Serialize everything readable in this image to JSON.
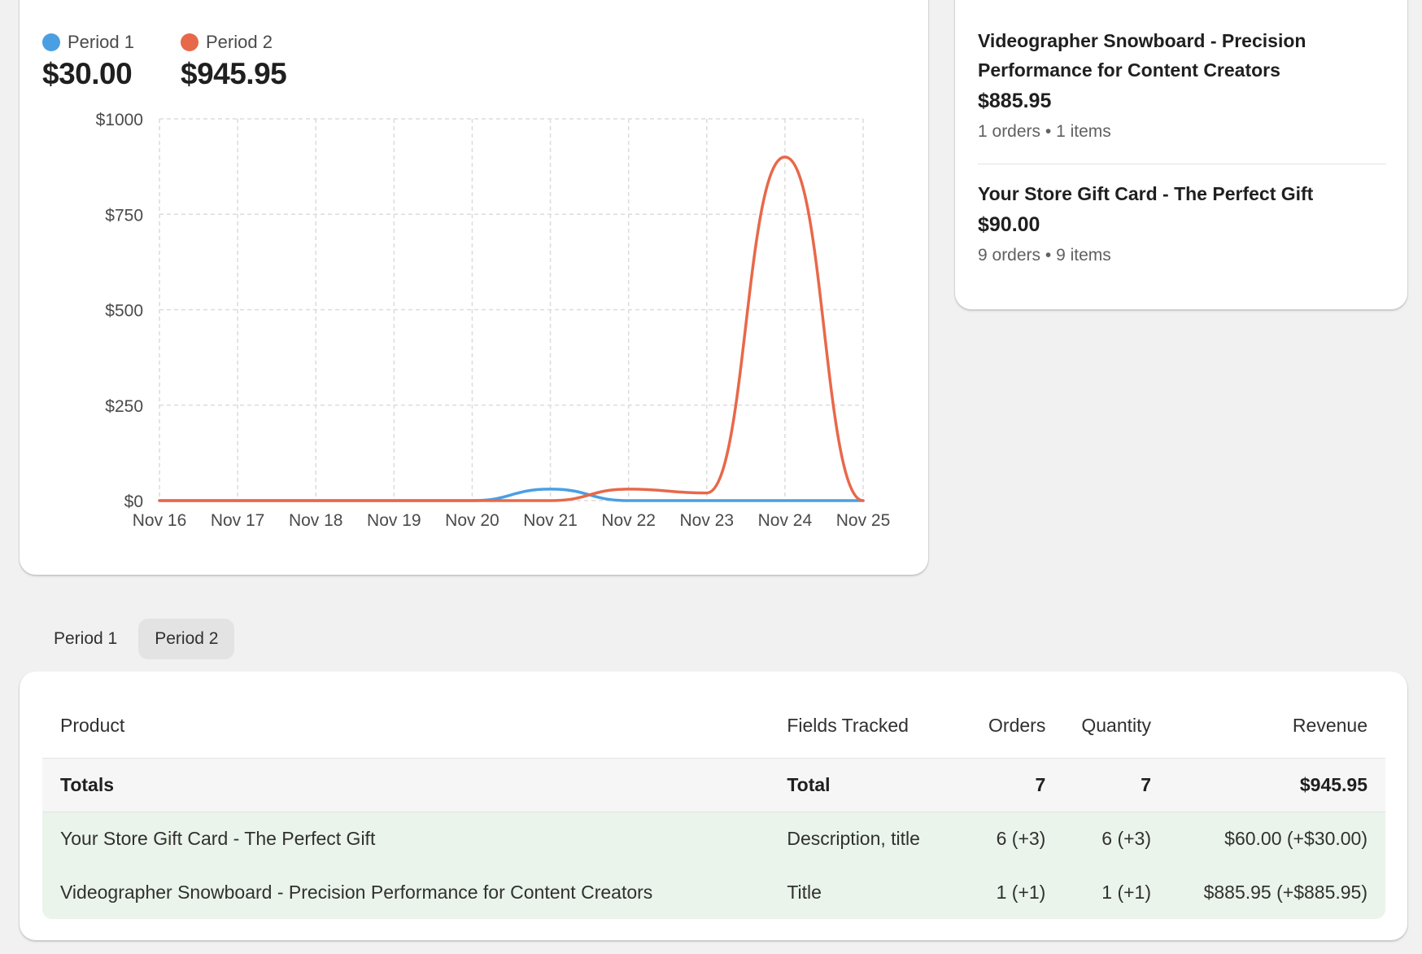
{
  "legend": [
    {
      "label": "Period 1",
      "value": "$30.00",
      "color": "#4a9fe3"
    },
    {
      "label": "Period 2",
      "value": "$945.95",
      "color": "#e8684a"
    }
  ],
  "chart_data": {
    "type": "line",
    "x": [
      "Nov 16",
      "Nov 17",
      "Nov 18",
      "Nov 19",
      "Nov 20",
      "Nov 21",
      "Nov 22",
      "Nov 23",
      "Nov 24",
      "Nov 25"
    ],
    "y_ticks": [
      "$0",
      "$250",
      "$500",
      "$750",
      "$1000"
    ],
    "ylim": [
      0,
      1000
    ],
    "grid": true,
    "series": [
      {
        "name": "Period 1",
        "color": "#4a9fe3",
        "values": [
          0,
          0,
          0,
          0,
          0,
          30,
          0,
          0,
          0,
          0
        ]
      },
      {
        "name": "Period 2",
        "color": "#e8684a",
        "values": [
          0,
          0,
          0,
          0,
          0,
          0,
          30,
          20,
          900,
          0
        ]
      }
    ]
  },
  "top_products": [
    {
      "title": "Videographer Snowboard - Precision Performance for Content Creators",
      "price": "$885.95",
      "orders": "1 orders",
      "items": "1 items"
    },
    {
      "title": "Your Store Gift Card - The Perfect Gift",
      "price": "$90.00",
      "orders": "9 orders",
      "items": "9 items"
    }
  ],
  "meta_separator": "•",
  "tabs": [
    {
      "label": "Period 1",
      "active": false
    },
    {
      "label": "Period 2",
      "active": true
    }
  ],
  "table": {
    "headers": {
      "product": "Product",
      "fields": "Fields Tracked",
      "orders": "Orders",
      "quantity": "Quantity",
      "revenue": "Revenue"
    },
    "totals": {
      "product": "Totals",
      "fields": "Total",
      "orders": "7",
      "quantity": "7",
      "revenue": "$945.95"
    },
    "rows": [
      {
        "product": "Your Store Gift Card - The Perfect Gift",
        "fields": "Description, title",
        "orders": "6 (+3)",
        "quantity": "6 (+3)",
        "revenue": "$60.00 (+$30.00)"
      },
      {
        "product": "Videographer Snowboard - Precision Performance for Content Creators",
        "fields": "Title",
        "orders": "1 (+1)",
        "quantity": "1 (+1)",
        "revenue": "$885.95 (+$885.95)"
      }
    ]
  }
}
